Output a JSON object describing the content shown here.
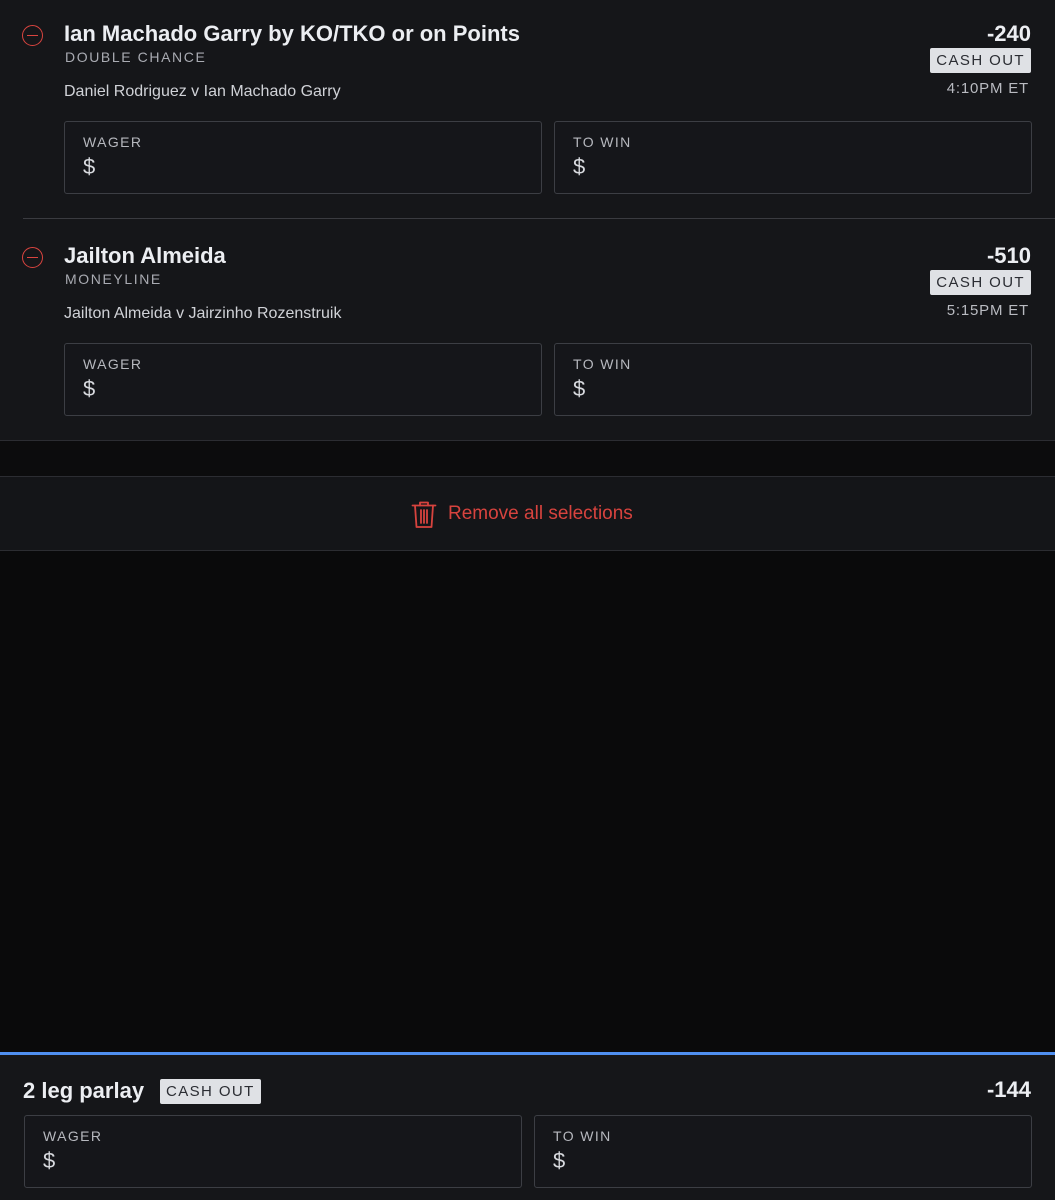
{
  "selections": [
    {
      "title": "Ian Machado Garry by KO/TKO or on Points",
      "market": "DOUBLE CHANCE",
      "event": "Daniel Rodriguez v Ian Machado Garry",
      "odds": "-240",
      "cash_out": "CASH OUT",
      "time": "4:10PM ET",
      "wager_label": "WAGER",
      "wager_value": "$",
      "to_win_label": "TO WIN",
      "to_win_value": "$"
    },
    {
      "title": "Jailton Almeida",
      "market": "MONEYLINE",
      "event": "Jailton Almeida v Jairzinho Rozenstruik",
      "odds": "-510",
      "cash_out": "CASH OUT",
      "time": "5:15PM ET",
      "wager_label": "WAGER",
      "wager_value": "$",
      "to_win_label": "TO WIN",
      "to_win_value": "$"
    }
  ],
  "remove_all": {
    "label": "Remove all selections",
    "icon": "trash-icon",
    "color": "#d7433e"
  },
  "parlay": {
    "title": "2 leg parlay",
    "cash_out": "CASH OUT",
    "odds": "-144",
    "wager_label": "WAGER",
    "wager_value": "$",
    "to_win_label": "TO WIN",
    "to_win_value": "$",
    "accent_color": "#4f8ff0"
  },
  "colors": {
    "background": "#0a0a0b",
    "card": "#151619",
    "remove": "#d9443f",
    "badge": "#dfe1e5"
  }
}
